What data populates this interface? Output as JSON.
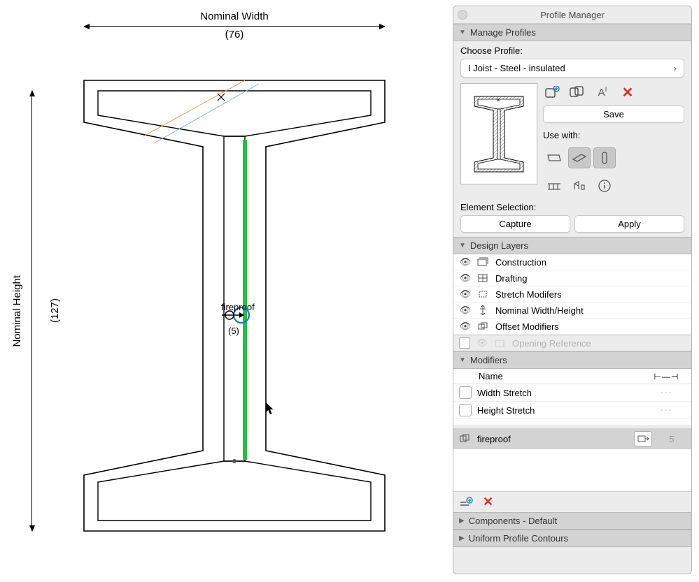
{
  "drawing": {
    "nominal_width_label": "Nominal Width",
    "nominal_width_value": "(76)",
    "nominal_height_label": "Nominal Height",
    "nominal_height_value": "(127)",
    "fireproof_label": "fireproof",
    "fireproof_value": "(5)"
  },
  "panel": {
    "title": "Profile Manager",
    "manage_profiles": {
      "header": "Manage Profiles",
      "choose_label": "Choose Profile:",
      "profile_name": "I Joist - Steel - insulated",
      "save_label": "Save",
      "use_with_label": "Use with:"
    },
    "element_selection": {
      "label": "Element Selection:",
      "capture": "Capture",
      "apply": "Apply"
    },
    "design_layers": {
      "header": "Design Layers",
      "items": [
        {
          "label": "Construction"
        },
        {
          "label": "Drafting"
        },
        {
          "label": "Stretch Modifers"
        },
        {
          "label": "Nominal Width/Height"
        },
        {
          "label": "Offset Modifiers"
        },
        {
          "label": "Opening Reference"
        }
      ]
    },
    "modifiers": {
      "header": "Modifiers",
      "name_col": "Name",
      "items": [
        {
          "label": "Width Stretch",
          "val": "---"
        },
        {
          "label": "Height Stretch",
          "val": "---"
        }
      ],
      "fireproof": {
        "label": "fireproof",
        "val": "5"
      }
    },
    "components_header": "Components - Default",
    "contours_header": "Uniform Profile Contours"
  }
}
